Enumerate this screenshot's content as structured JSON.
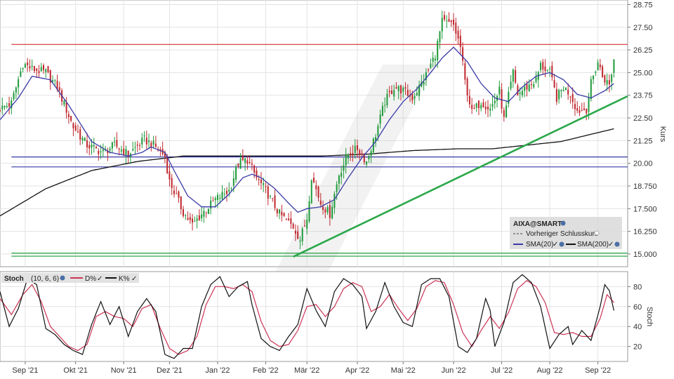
{
  "chart_data": [
    {
      "type": "candlestick",
      "legend": {
        "symbol": "AIXA@SMART",
        "items": [
          {
            "label": "Vorheriger Schlusskurs",
            "color": "#444444",
            "style": "dashed"
          },
          {
            "label": "SMA(20)",
            "color": "#3a3aa8"
          },
          {
            "label": "SMA(200)",
            "color": "#111111"
          }
        ]
      },
      "ylabel": "Kurs",
      "ylim": [
        14.3,
        29.0
      ],
      "yticks": [
        "28.75",
        "27.50",
        "26.25",
        "25.00",
        "23.75",
        "22.50",
        "21.25",
        "20.00",
        "18.750",
        "17.500",
        "16.250",
        "15.000"
      ],
      "ytick_values": [
        28.75,
        27.5,
        26.25,
        25.0,
        23.75,
        22.5,
        21.25,
        20.0,
        18.75,
        17.5,
        16.25,
        15.0
      ],
      "xlim": [
        0,
        274
      ],
      "xticks": [
        "Sep '21",
        "Okt '21",
        "Nov '21",
        "Dez '21",
        "Jan '22",
        "Feb '22",
        "Mär '22",
        "Apr '22",
        "Mai '22",
        "Jun '22",
        "Jul '22",
        "Aug '22",
        "Sep '22"
      ],
      "xtick_values": [
        11,
        33,
        54,
        74,
        95,
        116,
        134,
        156,
        176,
        198,
        219,
        240,
        261
      ],
      "close_anchors": [
        [
          0,
          23.0
        ],
        [
          5,
          23.3
        ],
        [
          10,
          25.5
        ],
        [
          14,
          25.2
        ],
        [
          20,
          25.0
        ],
        [
          25,
          24.2
        ],
        [
          32,
          22.0
        ],
        [
          38,
          21.0
        ],
        [
          45,
          20.6
        ],
        [
          50,
          21.0
        ],
        [
          56,
          20.5
        ],
        [
          63,
          21.3
        ],
        [
          67,
          21.0
        ],
        [
          72,
          20.4
        ],
        [
          74,
          19.0
        ],
        [
          80,
          17.3
        ],
        [
          84,
          16.6
        ],
        [
          88,
          17.2
        ],
        [
          94,
          18.0
        ],
        [
          100,
          18.5
        ],
        [
          104,
          20.0
        ],
        [
          108,
          20.2
        ],
        [
          112,
          19.2
        ],
        [
          116,
          18.5
        ],
        [
          122,
          17.2
        ],
        [
          128,
          16.5
        ],
        [
          131,
          15.8
        ],
        [
          134,
          17.0
        ],
        [
          136,
          19.3
        ],
        [
          140,
          17.8
        ],
        [
          144,
          17.2
        ],
        [
          148,
          19.4
        ],
        [
          152,
          20.5
        ],
        [
          156,
          20.8
        ],
        [
          160,
          20.1
        ],
        [
          164,
          21.6
        ],
        [
          168,
          23.4
        ],
        [
          172,
          24.2
        ],
        [
          176,
          24.0
        ],
        [
          180,
          23.6
        ],
        [
          185,
          24.6
        ],
        [
          190,
          26.0
        ],
        [
          193,
          27.8
        ],
        [
          198,
          27.6
        ],
        [
          201,
          26.4
        ],
        [
          203,
          24.5
        ],
        [
          206,
          22.8
        ],
        [
          210,
          23.4
        ],
        [
          214,
          23.0
        ],
        [
          218,
          24.0
        ],
        [
          220,
          22.4
        ],
        [
          224,
          25.0
        ],
        [
          226,
          23.8
        ],
        [
          230,
          24.2
        ],
        [
          234,
          24.6
        ],
        [
          236,
          25.4
        ],
        [
          240,
          25.0
        ],
        [
          243,
          23.6
        ],
        [
          246,
          24.2
        ],
        [
          249,
          23.8
        ],
        [
          252,
          22.9
        ],
        [
          256,
          23.0
        ],
        [
          258,
          24.4
        ],
        [
          261,
          25.6
        ],
        [
          263,
          24.8
        ],
        [
          266,
          24.3
        ],
        [
          268,
          25.7
        ]
      ],
      "sma20_anchors": [
        [
          0,
          22.4
        ],
        [
          8,
          23.6
        ],
        [
          14,
          24.8
        ],
        [
          22,
          24.6
        ],
        [
          30,
          23.2
        ],
        [
          40,
          21.2
        ],
        [
          48,
          20.6
        ],
        [
          56,
          20.4
        ],
        [
          62,
          20.6
        ],
        [
          66,
          20.9
        ],
        [
          72,
          20.6
        ],
        [
          76,
          19.6
        ],
        [
          82,
          18.2
        ],
        [
          88,
          17.6
        ],
        [
          94,
          17.6
        ],
        [
          100,
          18.3
        ],
        [
          106,
          19.2
        ],
        [
          110,
          19.4
        ],
        [
          114,
          19.2
        ],
        [
          120,
          18.6
        ],
        [
          126,
          17.8
        ],
        [
          130,
          17.3
        ],
        [
          134,
          17.5
        ],
        [
          140,
          17.6
        ],
        [
          146,
          18.0
        ],
        [
          152,
          19.2
        ],
        [
          158,
          20.3
        ],
        [
          164,
          21.2
        ],
        [
          170,
          22.4
        ],
        [
          176,
          23.4
        ],
        [
          182,
          24.1
        ],
        [
          188,
          25.0
        ],
        [
          193,
          25.8
        ],
        [
          198,
          26.4
        ],
        [
          204,
          25.6
        ],
        [
          210,
          24.4
        ],
        [
          216,
          23.6
        ],
        [
          222,
          23.4
        ],
        [
          228,
          24.2
        ],
        [
          234,
          24.8
        ],
        [
          240,
          25.0
        ],
        [
          246,
          24.6
        ],
        [
          252,
          23.8
        ],
        [
          258,
          23.6
        ],
        [
          264,
          24.0
        ],
        [
          268,
          24.4
        ]
      ],
      "sma200_anchors": [
        [
          0,
          17.1
        ],
        [
          20,
          18.6
        ],
        [
          40,
          19.6
        ],
        [
          60,
          20.1
        ],
        [
          80,
          20.4
        ],
        [
          100,
          20.4
        ],
        [
          120,
          20.4
        ],
        [
          140,
          20.4
        ],
        [
          160,
          20.5
        ],
        [
          180,
          20.7
        ],
        [
          200,
          20.8
        ],
        [
          215,
          20.8
        ],
        [
          230,
          21.0
        ],
        [
          245,
          21.2
        ],
        [
          258,
          21.6
        ],
        [
          268,
          21.9
        ]
      ],
      "horizontal_lines": [
        {
          "value": 26.55,
          "color": "#d23030"
        },
        {
          "value": 20.35,
          "color": "#3a3aa8"
        },
        {
          "value": 19.8,
          "color": "#3a3aa8"
        },
        {
          "value": 15.05,
          "color": "#2aa84a"
        },
        {
          "value": 14.88,
          "color": "#2aa84a"
        }
      ],
      "trendline": {
        "from": [
          128,
          14.85
        ],
        "to": [
          274,
          23.7
        ],
        "color": "#2aa84a"
      }
    },
    {
      "type": "line",
      "legend": {
        "title": "Stoch",
        "params": "(10, 6, 6)",
        "items": [
          {
            "label": "D%",
            "color": "#cc3355"
          },
          {
            "label": "K%",
            "color": "#111111"
          }
        ]
      },
      "ylabel": "Stoch",
      "ylim": [
        5,
        95
      ],
      "yticks": [
        "80",
        "60",
        "40",
        "20"
      ],
      "ytick_values": [
        80,
        60,
        40,
        20
      ],
      "k_anchors": [
        [
          0,
          75
        ],
        [
          4,
          40
        ],
        [
          8,
          58
        ],
        [
          12,
          88
        ],
        [
          16,
          82
        ],
        [
          20,
          38
        ],
        [
          24,
          32
        ],
        [
          28,
          22
        ],
        [
          32,
          16
        ],
        [
          36,
          12
        ],
        [
          40,
          42
        ],
        [
          44,
          65
        ],
        [
          48,
          42
        ],
        [
          52,
          60
        ],
        [
          56,
          30
        ],
        [
          60,
          55
        ],
        [
          64,
          68
        ],
        [
          68,
          55
        ],
        [
          72,
          12
        ],
        [
          76,
          8
        ],
        [
          80,
          18
        ],
        [
          84,
          18
        ],
        [
          88,
          60
        ],
        [
          92,
          82
        ],
        [
          96,
          90
        ],
        [
          100,
          70
        ],
        [
          104,
          80
        ],
        [
          108,
          85
        ],
        [
          110,
          62
        ],
        [
          114,
          28
        ],
        [
          118,
          20
        ],
        [
          122,
          16
        ],
        [
          126,
          30
        ],
        [
          130,
          42
        ],
        [
          134,
          78
        ],
        [
          138,
          56
        ],
        [
          142,
          40
        ],
        [
          146,
          75
        ],
        [
          150,
          88
        ],
        [
          154,
          82
        ],
        [
          158,
          70
        ],
        [
          160,
          38
        ],
        [
          164,
          55
        ],
        [
          168,
          84
        ],
        [
          172,
          60
        ],
        [
          176,
          44
        ],
        [
          180,
          40
        ],
        [
          184,
          82
        ],
        [
          188,
          88
        ],
        [
          192,
          88
        ],
        [
          196,
          70
        ],
        [
          200,
          20
        ],
        [
          204,
          14
        ],
        [
          208,
          28
        ],
        [
          212,
          68
        ],
        [
          214,
          56
        ],
        [
          216,
          20
        ],
        [
          220,
          44
        ],
        [
          224,
          84
        ],
        [
          228,
          92
        ],
        [
          232,
          84
        ],
        [
          236,
          60
        ],
        [
          240,
          18
        ],
        [
          244,
          32
        ],
        [
          248,
          40
        ],
        [
          250,
          22
        ],
        [
          254,
          36
        ],
        [
          258,
          26
        ],
        [
          262,
          60
        ],
        [
          264,
          82
        ],
        [
          266,
          76
        ],
        [
          268,
          56
        ]
      ],
      "d_anchors": [
        [
          0,
          68
        ],
        [
          5,
          52
        ],
        [
          10,
          72
        ],
        [
          14,
          82
        ],
        [
          18,
          65
        ],
        [
          22,
          40
        ],
        [
          26,
          30
        ],
        [
          30,
          20
        ],
        [
          34,
          16
        ],
        [
          38,
          22
        ],
        [
          42,
          50
        ],
        [
          46,
          55
        ],
        [
          50,
          50
        ],
        [
          54,
          48
        ],
        [
          58,
          40
        ],
        [
          62,
          58
        ],
        [
          66,
          62
        ],
        [
          70,
          38
        ],
        [
          74,
          18
        ],
        [
          78,
          12
        ],
        [
          82,
          16
        ],
        [
          86,
          30
        ],
        [
          90,
          62
        ],
        [
          94,
          80
        ],
        [
          98,
          80
        ],
        [
          102,
          78
        ],
        [
          106,
          82
        ],
        [
          110,
          75
        ],
        [
          114,
          45
        ],
        [
          118,
          26
        ],
        [
          122,
          20
        ],
        [
          126,
          22
        ],
        [
          130,
          36
        ],
        [
          134,
          60
        ],
        [
          138,
          62
        ],
        [
          142,
          50
        ],
        [
          146,
          60
        ],
        [
          150,
          78
        ],
        [
          154,
          84
        ],
        [
          158,
          80
        ],
        [
          162,
          55
        ],
        [
          166,
          60
        ],
        [
          170,
          72
        ],
        [
          174,
          58
        ],
        [
          178,
          46
        ],
        [
          182,
          58
        ],
        [
          186,
          80
        ],
        [
          190,
          86
        ],
        [
          194,
          84
        ],
        [
          198,
          62
        ],
        [
          202,
          34
        ],
        [
          206,
          20
        ],
        [
          210,
          36
        ],
        [
          214,
          50
        ],
        [
          218,
          38
        ],
        [
          222,
          54
        ],
        [
          226,
          78
        ],
        [
          230,
          86
        ],
        [
          234,
          80
        ],
        [
          238,
          64
        ],
        [
          242,
          34
        ],
        [
          246,
          32
        ],
        [
          250,
          34
        ],
        [
          254,
          30
        ],
        [
          258,
          30
        ],
        [
          262,
          48
        ],
        [
          265,
          72
        ],
        [
          268,
          64
        ]
      ]
    }
  ]
}
